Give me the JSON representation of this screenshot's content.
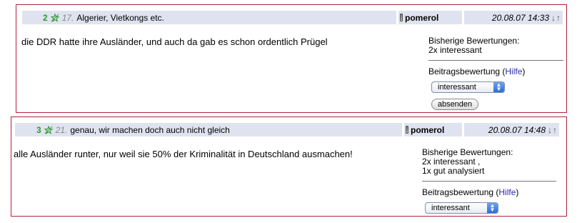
{
  "posts": [
    {
      "score": "2",
      "number": "17.",
      "title": "Algerier, Vietkongs etc.",
      "author": "pomerol",
      "date": "20.08.07 14:33",
      "arrows": "↓↑",
      "body": "die DDR hatte ihre Ausländer, und auch da gab es schon ordentlich Prügel",
      "ratings_heading": "Bisherige Bewertungen:",
      "ratings": [
        "2x interessant"
      ],
      "rate_label": "Beitragsbewertung (",
      "help_link": "Hilfe",
      "rate_close": ")",
      "select_value": "interessant",
      "submit_label": "absenden"
    },
    {
      "score": "3",
      "number": "21.",
      "title": "genau, wir machen doch auch nicht gleich",
      "author": "pomerol",
      "date": "20.08.07 14:48",
      "arrows": "↓↑",
      "body": "alle Ausländer runter, nur weil sie 50% der Kriminalität in Deutschland ausmachen!",
      "ratings_heading": "Bisherige Bewertungen:",
      "ratings": [
        "2x interessant ,",
        "1x gut analysiert"
      ],
      "rate_label": "Beitragsbewertung (",
      "help_link": "Hilfe",
      "rate_close": ")",
      "select_value": "interessant"
    }
  ],
  "colors": {
    "border": "#b0243a",
    "header_bg": "#dfe3f0",
    "score": "#2c9a2c",
    "link": "#2b2ba8"
  }
}
